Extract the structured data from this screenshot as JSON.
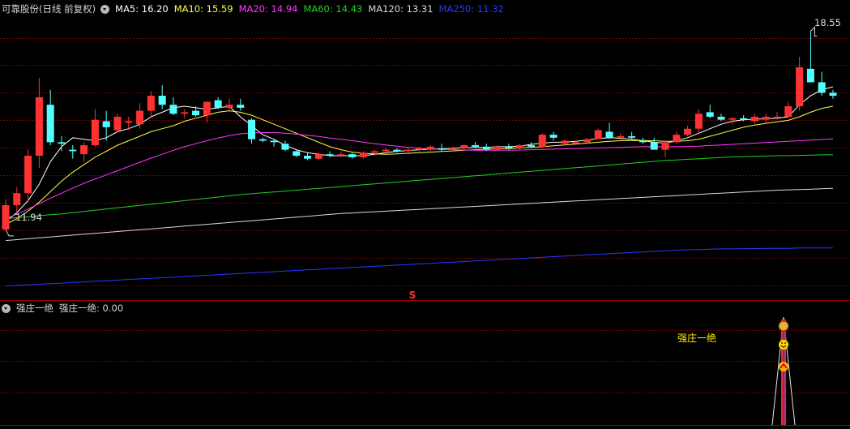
{
  "main_panel": {
    "title": "可靠股份(日线 前复权)",
    "ma_labels": [
      {
        "text": "MA5: 16.20",
        "color": "#ffffff"
      },
      {
        "text": "MA10: 15.59",
        "color": "#ffff3c"
      },
      {
        "text": "MA20: 14.94",
        "color": "#ff38ff"
      },
      {
        "text": "MA60: 14.43",
        "color": "#22d022"
      },
      {
        "text": "MA120: 13.31",
        "color": "#d9d9d9"
      },
      {
        "text": "MA250: 11.32",
        "color": "#2a38ff"
      }
    ],
    "high_label": "18.55",
    "low_label": "11.94",
    "signal_marker": "S"
  },
  "sub_panel": {
    "indicator_name": "强庄一绝",
    "indicator_value": "强庄一绝: 0.00",
    "signal_text": "强庄一绝"
  },
  "colors": {
    "up": "#ff3232",
    "down": "#54ffff",
    "grid": "#7a0000",
    "border": "#a00000"
  },
  "chart_data": {
    "type": "candlestick",
    "series": [
      {
        "name": "K线",
        "ohlc": [
          [
            11.94,
            12.95,
            11.94,
            12.75
          ],
          [
            12.75,
            13.35,
            12.5,
            13.15
          ],
          [
            13.15,
            14.6,
            12.85,
            14.4
          ],
          [
            14.4,
            17.0,
            14.0,
            16.35
          ],
          [
            16.1,
            16.6,
            14.75,
            14.85
          ],
          [
            14.85,
            15.05,
            14.55,
            14.8
          ],
          [
            14.6,
            14.75,
            14.3,
            14.55
          ],
          [
            14.45,
            14.85,
            14.2,
            14.75
          ],
          [
            14.75,
            15.95,
            14.7,
            15.6
          ],
          [
            15.55,
            15.9,
            14.9,
            15.35
          ],
          [
            15.25,
            15.8,
            15.2,
            15.7
          ],
          [
            15.5,
            15.7,
            15.25,
            15.55
          ],
          [
            15.45,
            16.15,
            15.3,
            15.9
          ],
          [
            15.9,
            16.55,
            15.7,
            16.4
          ],
          [
            16.4,
            16.75,
            15.95,
            16.1
          ],
          [
            16.1,
            16.35,
            15.75,
            15.8
          ],
          [
            15.8,
            15.95,
            15.65,
            15.85
          ],
          [
            15.9,
            16.05,
            15.7,
            15.75
          ],
          [
            15.75,
            16.2,
            15.5,
            16.2
          ],
          [
            16.25,
            16.35,
            15.95,
            16.0
          ],
          [
            16.0,
            16.3,
            15.85,
            16.1
          ],
          [
            16.1,
            16.3,
            15.9,
            16.0
          ],
          [
            15.6,
            15.65,
            14.8,
            14.95
          ],
          [
            14.95,
            15.0,
            14.85,
            14.9
          ],
          [
            14.9,
            14.95,
            14.7,
            14.85
          ],
          [
            14.8,
            14.9,
            14.55,
            14.6
          ],
          [
            14.55,
            14.6,
            14.35,
            14.4
          ],
          [
            14.4,
            14.5,
            14.25,
            14.3
          ],
          [
            14.3,
            14.5,
            14.25,
            14.45
          ],
          [
            14.45,
            14.55,
            14.35,
            14.4
          ],
          [
            14.4,
            14.55,
            14.35,
            14.45
          ],
          [
            14.45,
            14.5,
            14.3,
            14.35
          ],
          [
            14.35,
            14.55,
            14.3,
            14.5
          ],
          [
            14.5,
            14.6,
            14.4,
            14.55
          ],
          [
            14.55,
            14.65,
            14.45,
            14.6
          ],
          [
            14.6,
            14.65,
            14.5,
            14.55
          ],
          [
            14.55,
            14.7,
            14.5,
            14.6
          ],
          [
            14.6,
            14.7,
            14.55,
            14.65
          ],
          [
            14.6,
            14.75,
            14.55,
            14.7
          ],
          [
            14.65,
            14.8,
            14.55,
            14.6
          ],
          [
            14.6,
            14.7,
            14.55,
            14.65
          ],
          [
            14.65,
            14.8,
            14.6,
            14.75
          ],
          [
            14.75,
            14.85,
            14.65,
            14.7
          ],
          [
            14.7,
            14.8,
            14.55,
            14.6
          ],
          [
            14.6,
            14.75,
            14.55,
            14.7
          ],
          [
            14.7,
            14.8,
            14.6,
            14.65
          ],
          [
            14.65,
            14.8,
            14.6,
            14.75
          ],
          [
            14.75,
            14.85,
            14.65,
            14.7
          ],
          [
            14.7,
            15.15,
            14.7,
            15.1
          ],
          [
            15.1,
            15.2,
            14.9,
            15.0
          ],
          [
            14.8,
            14.95,
            14.75,
            14.9
          ],
          [
            14.8,
            14.9,
            14.75,
            14.85
          ],
          [
            14.85,
            15.0,
            14.8,
            14.95
          ],
          [
            14.95,
            15.3,
            14.95,
            15.25
          ],
          [
            15.2,
            15.5,
            14.95,
            15.0
          ],
          [
            15.0,
            15.15,
            14.9,
            15.05
          ],
          [
            15.05,
            15.2,
            14.95,
            15.0
          ],
          [
            14.9,
            15.0,
            14.8,
            14.85
          ],
          [
            14.85,
            15.0,
            14.75,
            14.6
          ],
          [
            14.6,
            14.9,
            14.35,
            14.85
          ],
          [
            14.85,
            15.2,
            14.8,
            15.1
          ],
          [
            15.1,
            15.4,
            15.05,
            15.3
          ],
          [
            15.3,
            15.95,
            15.15,
            15.8
          ],
          [
            15.85,
            16.1,
            15.65,
            15.7
          ],
          [
            15.7,
            15.8,
            15.55,
            15.6
          ],
          [
            15.6,
            15.7,
            15.45,
            15.65
          ],
          [
            15.65,
            15.75,
            15.55,
            15.6
          ],
          [
            15.55,
            15.8,
            15.45,
            15.7
          ],
          [
            15.6,
            15.8,
            15.5,
            15.7
          ],
          [
            15.7,
            15.85,
            15.6,
            15.7
          ],
          [
            15.7,
            16.2,
            15.7,
            16.05
          ],
          [
            16.05,
            17.7,
            15.9,
            17.35
          ],
          [
            17.3,
            18.55,
            16.9,
            16.85
          ],
          [
            16.85,
            17.2,
            16.4,
            16.5
          ],
          [
            16.5,
            16.6,
            16.3,
            16.4
          ]
        ]
      },
      {
        "name": "MA5",
        "values": [
          12.2,
          12.5,
          12.9,
          13.45,
          14.2,
          14.7,
          15.0,
          14.95,
          14.9,
          15.0,
          15.2,
          15.3,
          15.45,
          15.7,
          15.85,
          16.0,
          16.05,
          16.0,
          15.95,
          16.0,
          16.05,
          15.7,
          15.4,
          15.1,
          14.95,
          14.75,
          14.6,
          14.5,
          14.45,
          14.4,
          14.4,
          14.4,
          14.4,
          14.45,
          14.5,
          14.55,
          14.57,
          14.6,
          14.62,
          14.63,
          14.65,
          14.66,
          14.68,
          14.68,
          14.7,
          14.7,
          14.72,
          14.78,
          14.82,
          14.85,
          14.85,
          14.88,
          14.92,
          14.97,
          15.0,
          14.98,
          14.95,
          14.9,
          14.85,
          14.82,
          14.9,
          15.0,
          15.15,
          15.3,
          15.45,
          15.55,
          15.6,
          15.62,
          15.63,
          15.65,
          15.7,
          16.1,
          16.4,
          16.6,
          16.7
        ]
      },
      {
        "name": "MA10",
        "values": [
          12.1,
          12.3,
          12.55,
          12.85,
          13.2,
          13.55,
          13.85,
          14.1,
          14.35,
          14.55,
          14.75,
          14.9,
          15.05,
          15.2,
          15.3,
          15.4,
          15.55,
          15.65,
          15.75,
          15.85,
          15.9,
          15.85,
          15.75,
          15.6,
          15.45,
          15.3,
          15.15,
          15.0,
          14.85,
          14.7,
          14.6,
          14.52,
          14.48,
          14.46,
          14.45,
          14.46,
          14.48,
          14.5,
          14.52,
          14.54,
          14.56,
          14.58,
          14.6,
          14.62,
          14.63,
          14.64,
          14.66,
          14.68,
          14.7,
          14.73,
          14.76,
          14.79,
          14.82,
          14.85,
          14.88,
          14.9,
          14.91,
          14.91,
          14.9,
          14.88,
          14.88,
          14.9,
          14.95,
          15.05,
          15.15,
          15.25,
          15.35,
          15.42,
          15.48,
          15.53,
          15.58,
          15.7,
          15.85,
          15.98,
          16.05
        ]
      },
      {
        "name": "MA20",
        "values": [
          12.3,
          12.45,
          12.62,
          12.8,
          12.98,
          13.15,
          13.32,
          13.48,
          13.62,
          13.76,
          13.9,
          14.04,
          14.18,
          14.32,
          14.45,
          14.58,
          14.7,
          14.8,
          14.9,
          14.99,
          15.07,
          15.13,
          15.16,
          15.17,
          15.17,
          15.15,
          15.12,
          15.08,
          15.04,
          14.99,
          14.95,
          14.9,
          14.85,
          14.8,
          14.76,
          14.72,
          14.68,
          14.65,
          14.63,
          14.61,
          14.6,
          14.59,
          14.58,
          14.58,
          14.58,
          14.58,
          14.59,
          14.6,
          14.61,
          14.62,
          14.63,
          14.64,
          14.65,
          14.66,
          14.67,
          14.68,
          14.69,
          14.7,
          14.7,
          14.7,
          14.7,
          14.71,
          14.72,
          14.74,
          14.76,
          14.78,
          14.8,
          14.82,
          14.84,
          14.86,
          14.88,
          14.9,
          14.92,
          14.94,
          14.96
        ]
      },
      {
        "name": "MA60",
        "values": [
          12.3,
          12.33,
          12.36,
          12.4,
          12.43,
          12.46,
          12.5,
          12.54,
          12.58,
          12.62,
          12.66,
          12.7,
          12.74,
          12.78,
          12.82,
          12.86,
          12.9,
          12.94,
          12.98,
          13.02,
          13.06,
          13.1,
          13.13,
          13.16,
          13.19,
          13.22,
          13.25,
          13.28,
          13.31,
          13.34,
          13.37,
          13.4,
          13.43,
          13.46,
          13.49,
          13.52,
          13.55,
          13.58,
          13.61,
          13.64,
          13.67,
          13.7,
          13.73,
          13.76,
          13.79,
          13.82,
          13.85,
          13.88,
          13.91,
          13.94,
          13.97,
          14.0,
          14.03,
          14.06,
          14.09,
          14.12,
          14.15,
          14.18,
          14.21,
          14.24,
          14.26,
          14.28,
          14.3,
          14.32,
          14.34,
          14.36,
          14.37,
          14.38,
          14.39,
          14.4,
          14.4,
          14.41,
          14.42,
          14.43,
          14.43
        ]
      },
      {
        "name": "MA120",
        "values": [
          11.57,
          11.6,
          11.63,
          11.66,
          11.69,
          11.72,
          11.75,
          11.78,
          11.81,
          11.84,
          11.87,
          11.9,
          11.93,
          11.96,
          11.99,
          12.02,
          12.05,
          12.08,
          12.11,
          12.14,
          12.17,
          12.2,
          12.23,
          12.26,
          12.29,
          12.32,
          12.35,
          12.38,
          12.41,
          12.44,
          12.47,
          12.49,
          12.51,
          12.53,
          12.55,
          12.57,
          12.59,
          12.61,
          12.63,
          12.65,
          12.67,
          12.69,
          12.71,
          12.73,
          12.75,
          12.77,
          12.79,
          12.81,
          12.83,
          12.85,
          12.87,
          12.89,
          12.91,
          12.93,
          12.95,
          12.97,
          12.99,
          13.01,
          13.03,
          13.05,
          13.07,
          13.09,
          13.11,
          13.13,
          13.15,
          13.17,
          13.19,
          13.21,
          13.23,
          13.25,
          13.26,
          13.27,
          13.28,
          13.3,
          13.31
        ]
      },
      {
        "name": "MA250",
        "values": [
          10.05,
          10.07,
          10.09,
          10.11,
          10.13,
          10.15,
          10.17,
          10.19,
          10.21,
          10.23,
          10.25,
          10.27,
          10.29,
          10.31,
          10.33,
          10.35,
          10.37,
          10.39,
          10.41,
          10.43,
          10.45,
          10.47,
          10.49,
          10.51,
          10.53,
          10.55,
          10.57,
          10.59,
          10.61,
          10.63,
          10.65,
          10.67,
          10.69,
          10.71,
          10.73,
          10.75,
          10.77,
          10.79,
          10.81,
          10.83,
          10.85,
          10.87,
          10.89,
          10.91,
          10.93,
          10.95,
          10.97,
          10.99,
          11.01,
          11.03,
          11.05,
          11.07,
          11.09,
          11.11,
          11.13,
          11.15,
          11.17,
          11.19,
          11.21,
          11.23,
          11.25,
          11.26,
          11.27,
          11.28,
          11.29,
          11.29,
          11.3,
          11.3,
          11.31,
          11.31,
          11.31,
          11.32,
          11.32,
          11.32,
          11.32
        ]
      }
    ],
    "ylim": [
      9.8,
      19.0
    ],
    "signal_bar_index": 69
  }
}
